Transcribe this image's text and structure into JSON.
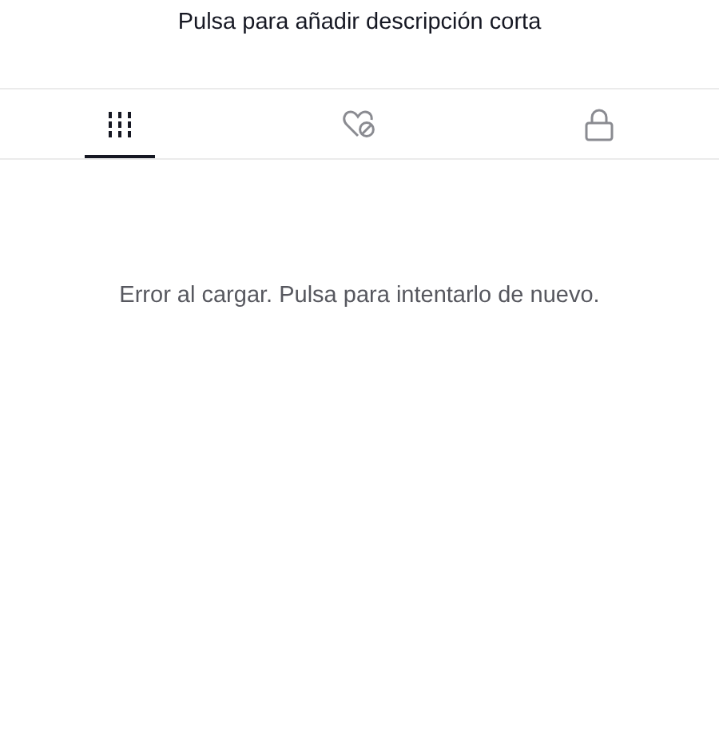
{
  "description": {
    "placeholder": "Pulsa para añadir descripción corta"
  },
  "tabs": [
    {
      "kind": "videos",
      "selected": true
    },
    {
      "kind": "liked",
      "selected": false
    },
    {
      "kind": "private",
      "selected": false
    }
  ],
  "error": "Error al cargar. Pulsa para intentarlo de nuevo."
}
